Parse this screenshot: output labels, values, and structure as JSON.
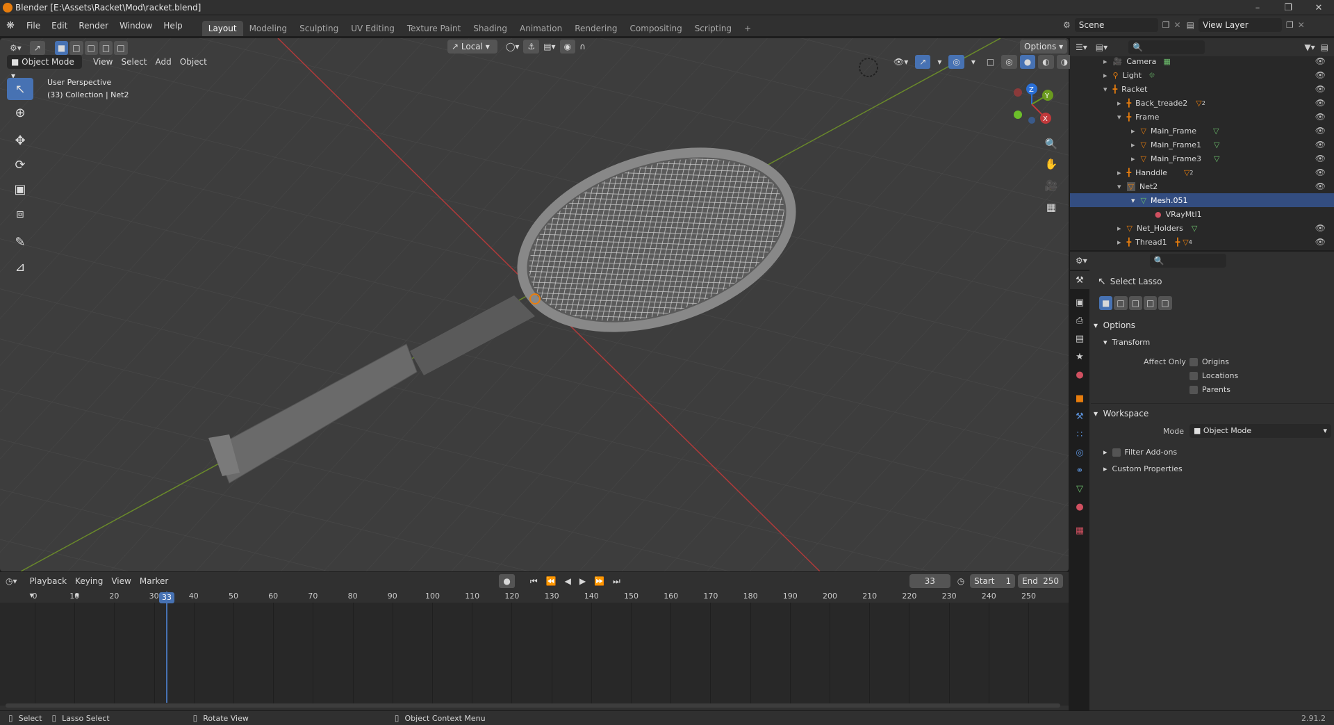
{
  "window": {
    "title": "Blender [E:\\Assets\\Racket\\Mod\\racket.blend]"
  },
  "menu": {
    "file": "File",
    "edit": "Edit",
    "render": "Render",
    "window": "Window",
    "help": "Help"
  },
  "workspaces": [
    "Layout",
    "Modeling",
    "Sculpting",
    "UV Editing",
    "Texture Paint",
    "Shading",
    "Animation",
    "Rendering",
    "Compositing",
    "Scripting"
  ],
  "scene": {
    "label": "Scene",
    "view_layer": "View Layer"
  },
  "viewport": {
    "mode": "Object Mode",
    "menus": [
      "View",
      "Select",
      "Add",
      "Object"
    ],
    "orientation": "Local",
    "options": "Options",
    "perspective": "User Perspective",
    "collection": "(33) Collection | Net2",
    "gizmo": {
      "x": "X",
      "y": "Y",
      "z": "Z"
    }
  },
  "outliner": {
    "items": [
      {
        "name": "Camera"
      },
      {
        "name": "Light"
      },
      {
        "name": "Racket"
      },
      {
        "name": "Back_treade2",
        "badge": "2"
      },
      {
        "name": "Frame"
      },
      {
        "name": "Main_Frame"
      },
      {
        "name": "Main_Frame1"
      },
      {
        "name": "Main_Frame3"
      },
      {
        "name": "Handdle",
        "badge": "2"
      },
      {
        "name": "Net2"
      },
      {
        "name": "Mesh.051"
      },
      {
        "name": "VRayMtl1"
      },
      {
        "name": "Net_Holders"
      },
      {
        "name": "Thread1",
        "badge": "4"
      }
    ]
  },
  "properties": {
    "tool_name": "Select Lasso",
    "options": "Options",
    "transform": "Transform",
    "affect_only": "Affect Only",
    "origins": "Origins",
    "locations": "Locations",
    "parents": "Parents",
    "workspace": "Workspace",
    "mode_label": "Mode",
    "mode_value": "Object Mode",
    "filter_addons": "Filter Add-ons",
    "custom_props": "Custom Properties"
  },
  "timeline": {
    "menus": [
      "Playback",
      "Keying",
      "View",
      "Marker"
    ],
    "current_frame": "33",
    "start_label": "Start",
    "start": "1",
    "end_label": "End",
    "end": "250",
    "ticks": [
      "0",
      "10",
      "20",
      "30",
      "40",
      "50",
      "60",
      "70",
      "80",
      "90",
      "100",
      "110",
      "120",
      "130",
      "140",
      "150",
      "160",
      "170",
      "180",
      "190",
      "200",
      "210",
      "220",
      "230",
      "240",
      "250"
    ]
  },
  "status": {
    "select": "Select",
    "lasso": "Lasso Select",
    "rotate": "Rotate View",
    "context": "Object Context Menu",
    "version": "2.91.2"
  },
  "colors": {
    "accent": "#4772b3",
    "x_axis": "#c0393b",
    "y_axis": "#6a9a1f",
    "z_axis": "#2a6fd6",
    "orange": "#e87d0d"
  }
}
